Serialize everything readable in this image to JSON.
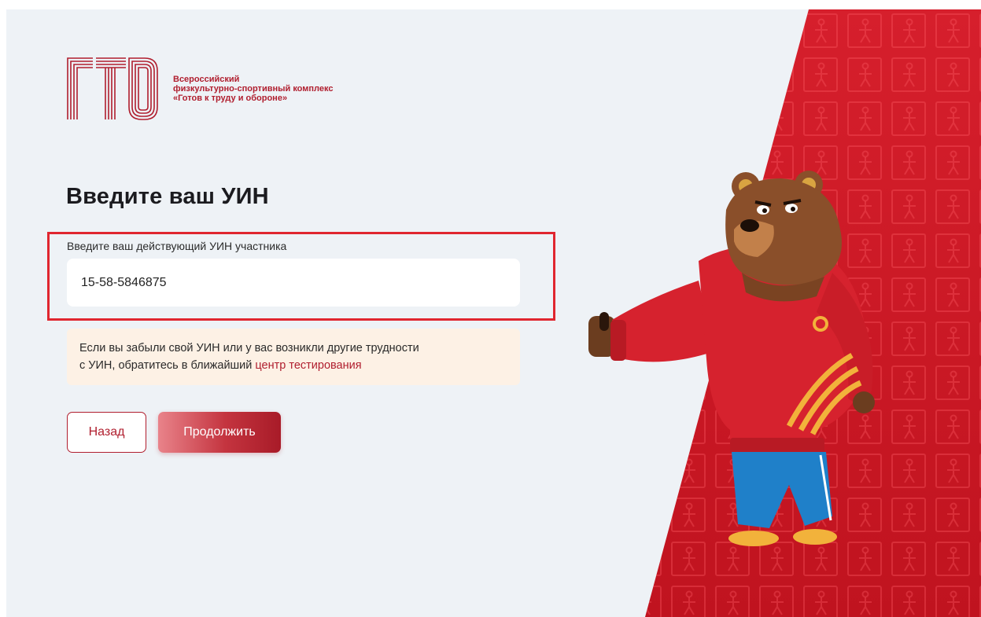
{
  "brand": {
    "logo_text_line1": "Всероссийский",
    "logo_text_line2": "физкультурно-спортивный комплекс",
    "logo_text_line3": "«Готов к труду и обороне»",
    "accent_color": "#b01e2e"
  },
  "form": {
    "title": "Введите ваш УИН",
    "field_label": "Введите ваш действующий УИН участника",
    "uin_value": "15-58-5846875"
  },
  "note": {
    "text_line1": "Если вы забыли свой УИН или у вас возникли другие трудности",
    "text_line2_prefix": "с УИН, обратитесь в ближайший ",
    "link_text": "центр тестирования"
  },
  "buttons": {
    "back_label": "Назад",
    "continue_label": "Продолжить"
  },
  "icons": {
    "logo": "gto-logo-icon",
    "mascot": "bear-mascot-icon"
  }
}
